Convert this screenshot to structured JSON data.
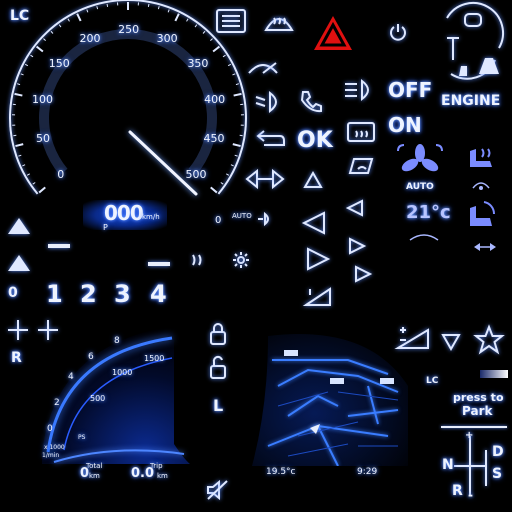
{
  "speedometer": {
    "lc_label": "LC",
    "ticks": [
      "0",
      "50",
      "100",
      "150",
      "200",
      "250",
      "300",
      "350",
      "400",
      "450",
      "500"
    ],
    "digital_speed": "000",
    "speed_unit": "km/h",
    "gear_indicator": "P",
    "needle_value": 460,
    "auto_label": "AUTO",
    "zero_label": "0"
  },
  "hvac": {
    "status_off": "OFF",
    "status_on": "ON",
    "engine_label": "ENGINE",
    "ok_label": "OK",
    "auto_label": "AUTO",
    "temperature": "21°c"
  },
  "gear_numbers": [
    "0",
    "1",
    "2",
    "3",
    "4"
  ],
  "reverse_label": "R",
  "lower_cluster": {
    "tach_ticks": [
      "0",
      "2",
      "4",
      "6",
      "8"
    ],
    "speed_ticks": [
      "500",
      "1000",
      "1500"
    ],
    "unit_a": "x 1000",
    "unit_b": "1/min",
    "total_label": "Total",
    "total_value": "0",
    "total_unit": "km",
    "trip_label": "Trip",
    "trip_value": "0.0",
    "trip_unit": "km",
    "ps_label": "PS"
  },
  "navigation": {
    "outside_temp": "19.5°c",
    "clock": "9:29"
  },
  "park_panel": {
    "lc_label": "LC",
    "press_line1": "press to",
    "press_line2": "Park",
    "shift_letters": [
      "N",
      "D",
      "S",
      "R"
    ],
    "plus": "+",
    "minus": "-"
  },
  "lock_l_label": "L",
  "colors": {
    "background": "#000000",
    "glow_blue": "#2a5cff",
    "hazard_red": "#e01010",
    "accent_violet": "#7b8cff"
  }
}
